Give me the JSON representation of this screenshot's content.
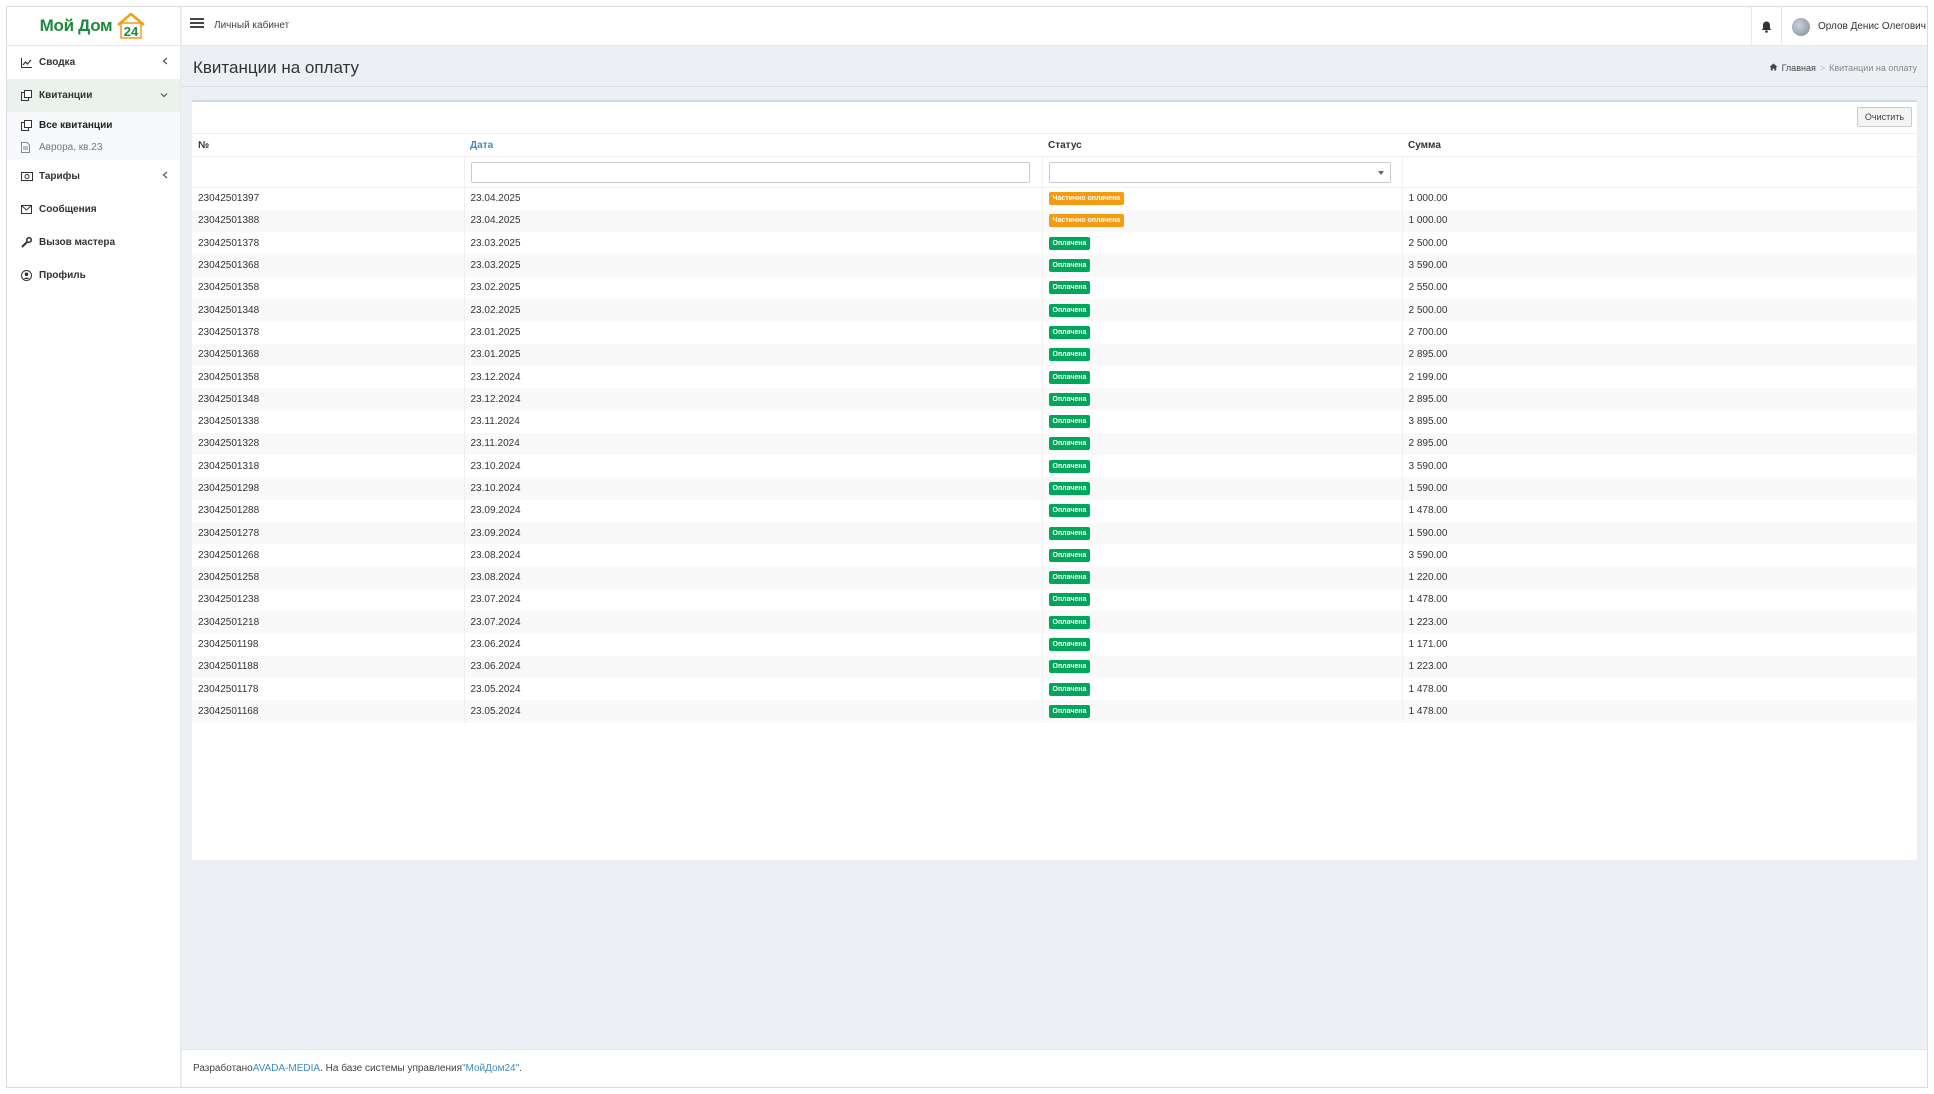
{
  "brand": {
    "name": "Мой Дом",
    "number": "24"
  },
  "topbar": {
    "title": "Личный кабинет",
    "user_name": "Орлов Денис Олегович"
  },
  "sidebar": {
    "items": [
      {
        "label": "Сводка"
      },
      {
        "label": "Квитанции"
      },
      {
        "label": "Тарифы"
      },
      {
        "label": "Сообщения"
      },
      {
        "label": "Вызов мастера"
      },
      {
        "label": "Профиль"
      }
    ],
    "sub": [
      {
        "label": "Все квитанции"
      },
      {
        "label": "Аврора, кв.23"
      }
    ]
  },
  "page": {
    "title": "Квитанции на оплату"
  },
  "breadcrumb": {
    "home": "Главная",
    "current": "Квитанции на оплату"
  },
  "toolbar": {
    "clear_label": "Очистить"
  },
  "table": {
    "columns": [
      "№",
      "Дата",
      "Статус",
      "Сумма"
    ],
    "rows": [
      {
        "num": "23042501397",
        "date": "23.04.2025",
        "status": "Частично оплачена",
        "sum": "1 000.00"
      },
      {
        "num": "23042501388",
        "date": "23.04.2025",
        "status": "Частично оплачена",
        "sum": "1 000.00"
      },
      {
        "num": "23042501378",
        "date": "23.03.2025",
        "status": "Оплачена",
        "sum": "2 500.00"
      },
      {
        "num": "23042501368",
        "date": "23.03.2025",
        "status": "Оплачена",
        "sum": "3 590.00"
      },
      {
        "num": "23042501358",
        "date": "23.02.2025",
        "status": "Оплачена",
        "sum": "2 550.00"
      },
      {
        "num": "23042501348",
        "date": "23.02.2025",
        "status": "Оплачена",
        "sum": "2 500.00"
      },
      {
        "num": "23042501378",
        "date": "23.01.2025",
        "status": "Оплачена",
        "sum": "2 700.00"
      },
      {
        "num": "23042501368",
        "date": "23.01.2025",
        "status": "Оплачена",
        "sum": "2 895.00"
      },
      {
        "num": "23042501358",
        "date": "23.12.2024",
        "status": "Оплачена",
        "sum": "2 199.00"
      },
      {
        "num": "23042501348",
        "date": "23.12.2024",
        "status": "Оплачена",
        "sum": "2 895.00"
      },
      {
        "num": "23042501338",
        "date": "23.11.2024",
        "status": "Оплачена",
        "sum": "3 895.00"
      },
      {
        "num": "23042501328",
        "date": "23.11.2024",
        "status": "Оплачена",
        "sum": "2 895.00"
      },
      {
        "num": "23042501318",
        "date": "23.10.2024",
        "status": "Оплачена",
        "sum": "3 590.00"
      },
      {
        "num": "23042501298",
        "date": "23.10.2024",
        "status": "Оплачена",
        "sum": "1 590.00"
      },
      {
        "num": "23042501288",
        "date": "23.09.2024",
        "status": "Оплачена",
        "sum": "1 478.00"
      },
      {
        "num": "23042501278",
        "date": "23.09.2024",
        "status": "Оплачена",
        "sum": "1 590.00"
      },
      {
        "num": "23042501268",
        "date": "23.08.2024",
        "status": "Оплачена",
        "sum": "3 590.00"
      },
      {
        "num": "23042501258",
        "date": "23.08.2024",
        "status": "Оплачена",
        "sum": "1 220.00"
      },
      {
        "num": "23042501238",
        "date": "23.07.2024",
        "status": "Оплачена",
        "sum": "1 478.00"
      },
      {
        "num": "23042501218",
        "date": "23.07.2024",
        "status": "Оплачена",
        "sum": "1 223.00"
      },
      {
        "num": "23042501198",
        "date": "23.06.2024",
        "status": "Оплачена",
        "sum": "1 171.00"
      },
      {
        "num": "23042501188",
        "date": "23.06.2024",
        "status": "Оплачена",
        "sum": "1 223.00"
      },
      {
        "num": "23042501178",
        "date": "23.05.2024",
        "status": "Оплачена",
        "sum": "1 478.00"
      },
      {
        "num": "23042501168",
        "date": "23.05.2024",
        "status": "Оплачена",
        "sum": "1 478.00"
      }
    ]
  },
  "footer": {
    "prefix": "Разработано ",
    "company": "AVADA-MEDIA",
    "middle": ". На базе системы управления ",
    "system": "\"МойДом24\"",
    "suffix": "."
  },
  "colors": {
    "paid": "#00a65a",
    "partial": "#f39c12",
    "link": "#3c8dbc",
    "brand": "#1d8a3c"
  }
}
